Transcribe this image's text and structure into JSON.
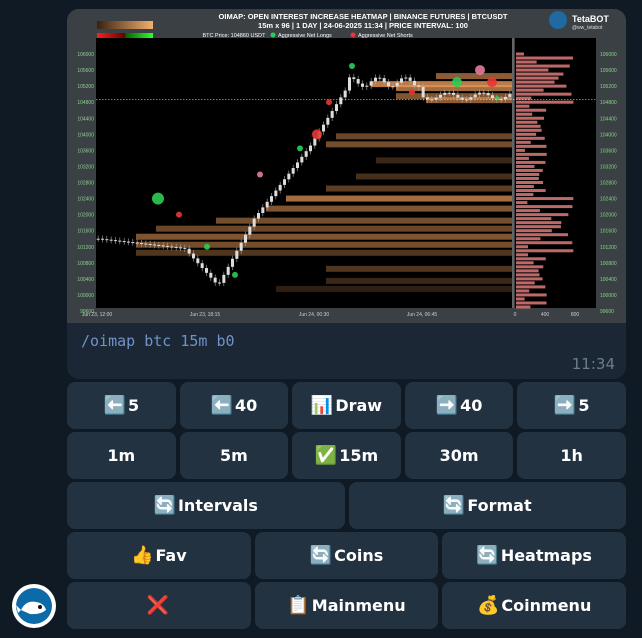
{
  "message": {
    "chart": {
      "title_line1": "OIMAP: OPEN INTEREST INCREASE HEATMAP | BINANCE FUTURES | BTCUSDT",
      "title_line2": "15m x 96 | 1 DAY | 24-06-2025 11:34 | PRICE INTERVAL: 100",
      "brand": "TetaBOT",
      "brand_sub": "@ww_tetabot",
      "legend_price": "BTC Price: 104860 USDT",
      "legend_longs": "Aggressive Net Longs",
      "legend_shorts": "Aggressive Net Shorts",
      "colors": {
        "longs": "#2ecc55",
        "shorts": "#e53935",
        "heat": "#f0a060",
        "profile": "#e07a7a"
      },
      "chart_data": {
        "type": "heatmap",
        "y_ticks_left": [
          "106000",
          "105600",
          "105200",
          "104800",
          "104400",
          "104000",
          "103600",
          "103200",
          "102800",
          "102400",
          "102000",
          "101600",
          "101200",
          "100800",
          "100400",
          "100000",
          "99600"
        ],
        "y_ticks_right": [
          "106000",
          "105600",
          "105200",
          "104800",
          "104400",
          "104000",
          "103600",
          "103200",
          "102800",
          "102400",
          "102000",
          "101600",
          "101200",
          "100800",
          "100400",
          "100000",
          "99600"
        ],
        "x_ticks": [
          "Jun 23, 12:00",
          "Jun 23, 18:15",
          "Jun 24, 00:30",
          "Jun 24, 06:45"
        ],
        "profile_x_ticks": [
          "0",
          "400",
          "800"
        ],
        "ylim": [
          99500,
          106200
        ],
        "current_price": 104860
      }
    },
    "command": "/oimap btc 15m b0",
    "time": "11:34"
  },
  "keyboard": {
    "rows": [
      [
        {
          "icon": "⬅️",
          "label": "5",
          "name": "back-5-button"
        },
        {
          "icon": "⬅️",
          "label": "40",
          "name": "back-40-button"
        },
        {
          "icon": "📊",
          "label": "Draw",
          "name": "draw-button"
        },
        {
          "icon": "➡️",
          "label": "40",
          "name": "forward-40-button"
        },
        {
          "icon": "➡️",
          "label": "5",
          "name": "forward-5-button"
        }
      ],
      [
        {
          "icon": "",
          "label": "1m",
          "name": "interval-1m-button"
        },
        {
          "icon": "",
          "label": "5m",
          "name": "interval-5m-button"
        },
        {
          "icon": "✅",
          "label": "15m",
          "name": "interval-15m-button"
        },
        {
          "icon": "",
          "label": "30m",
          "name": "interval-30m-button"
        },
        {
          "icon": "",
          "label": "1h",
          "name": "interval-1h-button"
        }
      ],
      [
        {
          "icon": "🔄",
          "label": "Intervals",
          "name": "intervals-button"
        },
        {
          "icon": "🔄",
          "label": "Format",
          "name": "format-button"
        }
      ],
      [
        {
          "icon": "👍",
          "label": "Fav",
          "name": "fav-button"
        },
        {
          "icon": "🔄",
          "label": "Coins",
          "name": "coins-button"
        },
        {
          "icon": "🔄",
          "label": "Heatmaps",
          "name": "heatmaps-button"
        }
      ],
      [
        {
          "icon": "❌",
          "label": "",
          "name": "close-button"
        },
        {
          "icon": "📋",
          "label": "Mainmenu",
          "name": "mainmenu-button"
        },
        {
          "icon": "💰",
          "label": "Coinmenu",
          "name": "coinmenu-button"
        }
      ]
    ]
  }
}
